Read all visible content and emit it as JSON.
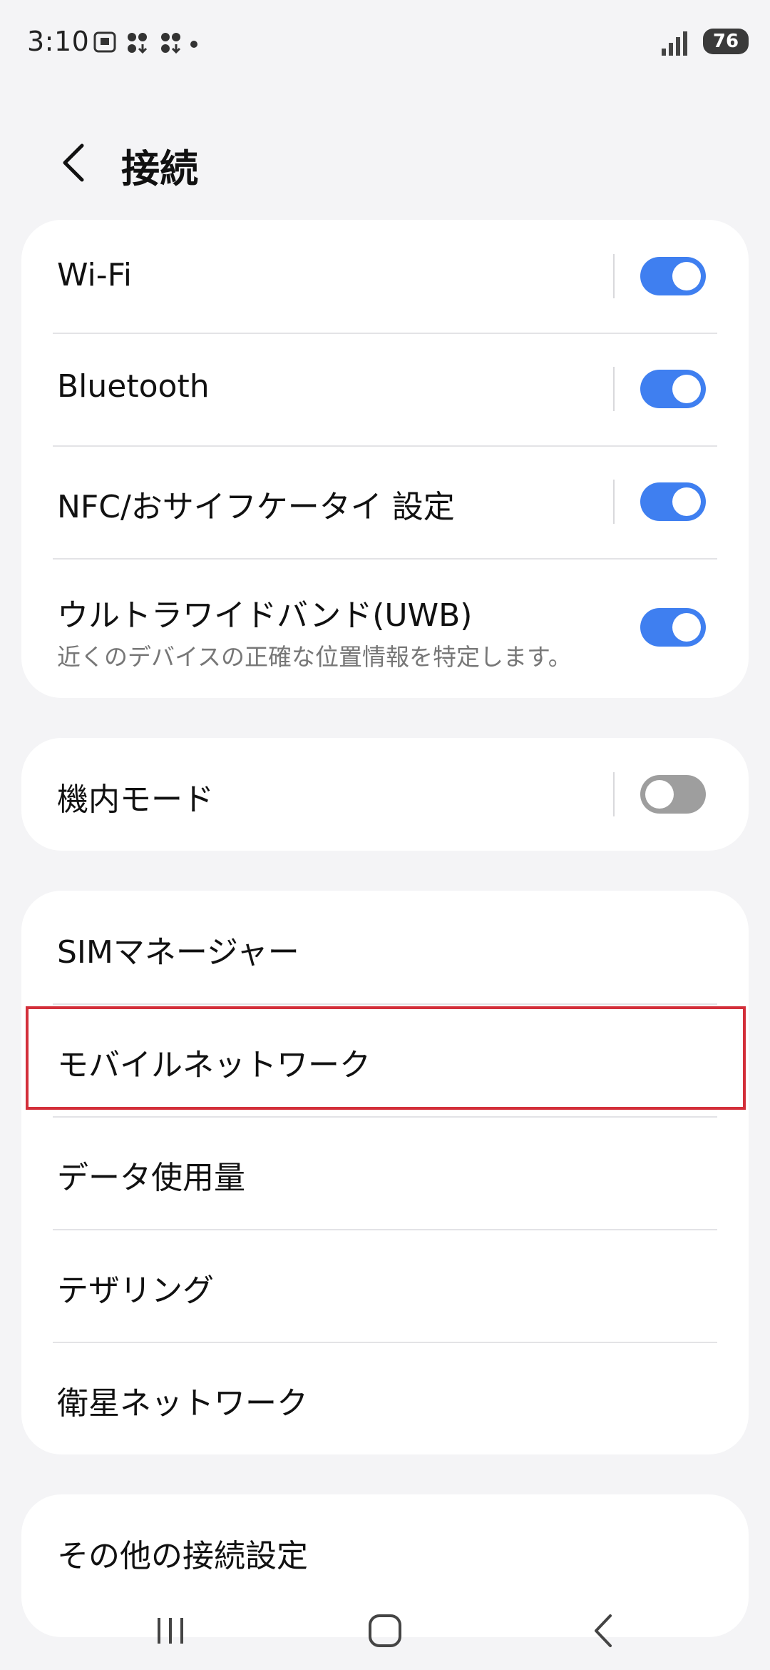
{
  "status": {
    "time": "3:10",
    "battery": "76",
    "icons": [
      "screenshot-icon",
      "download-icon",
      "download-icon",
      "dot-icon",
      "signal-icon",
      "battery-icon"
    ]
  },
  "header": {
    "title": "接続",
    "back_icon": "chevron-left-icon"
  },
  "card1": {
    "wifi": {
      "label": "Wi-Fi",
      "toggle": "on"
    },
    "bluetooth": {
      "label": "Bluetooth",
      "toggle": "on"
    },
    "nfc": {
      "label": "NFC/おサイフケータイ 設定",
      "toggle": "on"
    },
    "uwb": {
      "label": "ウルトラワイドバンド(UWB)",
      "sublabel": "近くのデバイスの正確な位置情報を特定します。",
      "toggle": "on"
    }
  },
  "card2": {
    "airplane": {
      "label": "機内モード",
      "toggle": "off"
    }
  },
  "card3": {
    "sim": {
      "label": "SIMマネージャー"
    },
    "mobile": {
      "label": "モバイルネットワーク"
    },
    "data": {
      "label": "データ使用量"
    },
    "tethering": {
      "label": "テザリング"
    },
    "satellite": {
      "label": "衛星ネットワーク"
    }
  },
  "card4": {
    "more": {
      "label": "その他の接続設定"
    }
  },
  "colors": {
    "accent": "#3f7ff0",
    "background": "#f4f4f6",
    "highlight": "#d32f3a"
  },
  "navbar": {
    "icons": [
      "recents-icon",
      "home-icon",
      "back-icon"
    ]
  }
}
